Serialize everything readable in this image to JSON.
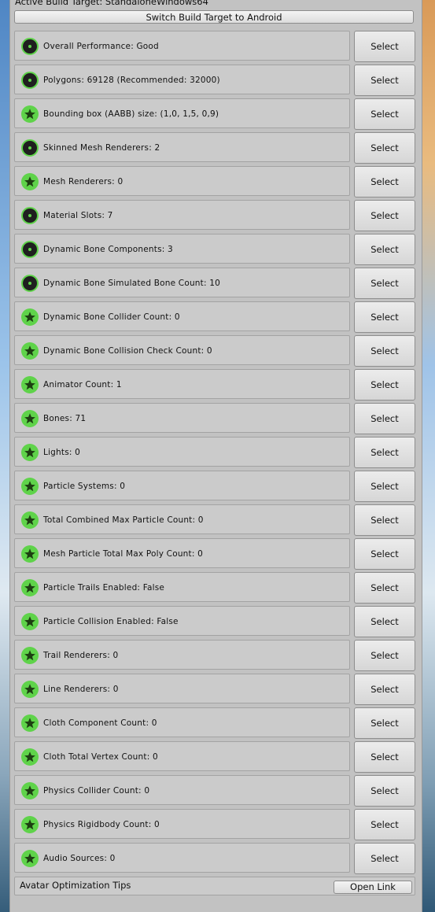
{
  "header": {
    "active_build_target": "Active Build Target: StandaloneWindows64",
    "switch_button": "Switch Build Target to Android"
  },
  "icon_names": {
    "good": "star-icon",
    "medium": "circle-dot-icon"
  },
  "colors": {
    "good_green": "#5fd34a",
    "medium_dark": "#1f1f1f",
    "panel": "#c2c2c2"
  },
  "select_label": "Select",
  "rows": [
    {
      "label": "Overall Performance: Good",
      "rating": "medium"
    },
    {
      "label": "Polygons: 69128 (Recommended: 32000)",
      "rating": "medium"
    },
    {
      "label": "Bounding box (AABB) size: (1,0, 1,5, 0,9)",
      "rating": "good"
    },
    {
      "label": "Skinned Mesh Renderers: 2",
      "rating": "medium"
    },
    {
      "label": "Mesh Renderers: 0",
      "rating": "good"
    },
    {
      "label": "Material Slots: 7",
      "rating": "medium"
    },
    {
      "label": "Dynamic Bone Components: 3",
      "rating": "medium"
    },
    {
      "label": "Dynamic Bone Simulated Bone Count: 10",
      "rating": "medium"
    },
    {
      "label": "Dynamic Bone Collider Count: 0",
      "rating": "good"
    },
    {
      "label": "Dynamic Bone Collision Check Count: 0",
      "rating": "good"
    },
    {
      "label": "Animator Count: 1",
      "rating": "good"
    },
    {
      "label": "Bones: 71",
      "rating": "good"
    },
    {
      "label": "Lights: 0",
      "rating": "good"
    },
    {
      "label": "Particle Systems: 0",
      "rating": "good"
    },
    {
      "label": "Total Combined Max Particle Count: 0",
      "rating": "good"
    },
    {
      "label": "Mesh Particle Total Max Poly Count: 0",
      "rating": "good"
    },
    {
      "label": "Particle Trails Enabled: False",
      "rating": "good"
    },
    {
      "label": "Particle Collision Enabled: False",
      "rating": "good"
    },
    {
      "label": "Trail Renderers: 0",
      "rating": "good"
    },
    {
      "label": "Line Renderers: 0",
      "rating": "good"
    },
    {
      "label": "Cloth Component Count: 0",
      "rating": "good"
    },
    {
      "label": "Cloth Total Vertex Count: 0",
      "rating": "good"
    },
    {
      "label": "Physics Collider Count: 0",
      "rating": "good"
    },
    {
      "label": "Physics Rigidbody Count: 0",
      "rating": "good"
    },
    {
      "label": "Audio Sources: 0",
      "rating": "good"
    }
  ],
  "footer": {
    "tips_label": "Avatar Optimization Tips",
    "open_link": "Open Link"
  }
}
